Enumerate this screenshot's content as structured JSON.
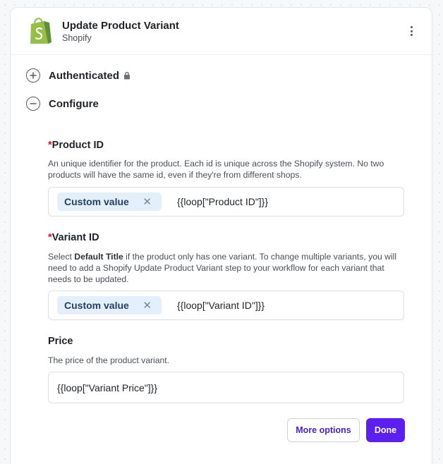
{
  "header": {
    "title": "Update Product Variant",
    "subtitle": "Shopify",
    "logo_icon": "shopify-bag-icon",
    "menu_icon": "kebab-menu-icon"
  },
  "sections": {
    "authenticated": {
      "label": "Authenticated",
      "icon": "plus-circle-icon",
      "badge_icon": "lock-icon"
    },
    "configure": {
      "label": "Configure",
      "icon": "minus-circle-icon"
    }
  },
  "fields": {
    "product_id": {
      "required_marker": "*",
      "label": "Product ID",
      "description": "An unique identifier for the product. Each id is unique across the Shopify system. No two products will have the same id, even if they're from different shops.",
      "chip_label": "Custom value",
      "value": "{{loop[\"Product ID\"]}}"
    },
    "variant_id": {
      "required_marker": "*",
      "label": "Variant ID",
      "description_pre": "Select ",
      "description_bold": "Default Title",
      "description_post": " if the product only has one variant. To change multiple variants, you will need to add a Shopify Update Product Variant step to your workflow for each variant that needs to be updated.",
      "chip_label": "Custom value",
      "value": "{{loop[\"Variant ID\"]}}"
    },
    "price": {
      "label": "Price",
      "description": "The price of the product variant.",
      "value": "{{loop[\"Variant Price\"]}}"
    }
  },
  "actions": {
    "more_options_label": "More options",
    "done_label": "Done"
  },
  "colors": {
    "accent": "#5b1ff2",
    "required": "#e0112b",
    "chip_bg": "#e3f0fb",
    "shopify_green": "#95bf47"
  }
}
